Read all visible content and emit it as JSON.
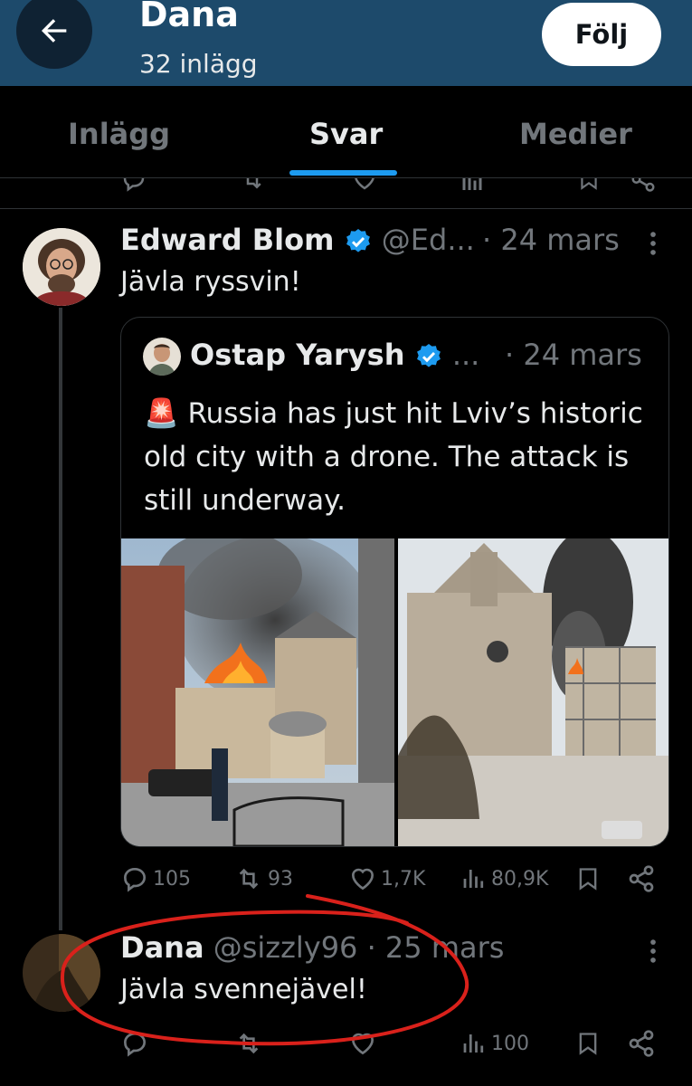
{
  "header": {
    "name": "Dana",
    "post_count": "32 inlägg",
    "follow_label": "Följ"
  },
  "tabs": [
    {
      "label": "Inlägg",
      "active": false
    },
    {
      "label": "Svar",
      "active": true
    },
    {
      "label": "Medier",
      "active": false
    }
  ],
  "tweet1": {
    "name": "Edward Blom",
    "handle": "@Ed...",
    "time": "· 24 mars",
    "text": "Jävla ryssvin!",
    "quote": {
      "name": "Ostap Yarysh",
      "handle": "...",
      "time": "· 24 mars",
      "siren": "🚨",
      "text": "Russia has just hit Lviv’s historic old city with a drone. The attack is still underway."
    },
    "stats": {
      "replies": "105",
      "reposts": "93",
      "likes": "1,7K",
      "views": "80,9K"
    }
  },
  "tweet2": {
    "name": "Dana",
    "handle": "@sizzly96",
    "time": "· 25 mars",
    "text": "Jävla svennejävel!",
    "stats": {
      "views": "100"
    }
  },
  "colors": {
    "accent": "#1d9bf0",
    "header_bg": "#1d4a6b",
    "annotation": "#d9211b"
  }
}
